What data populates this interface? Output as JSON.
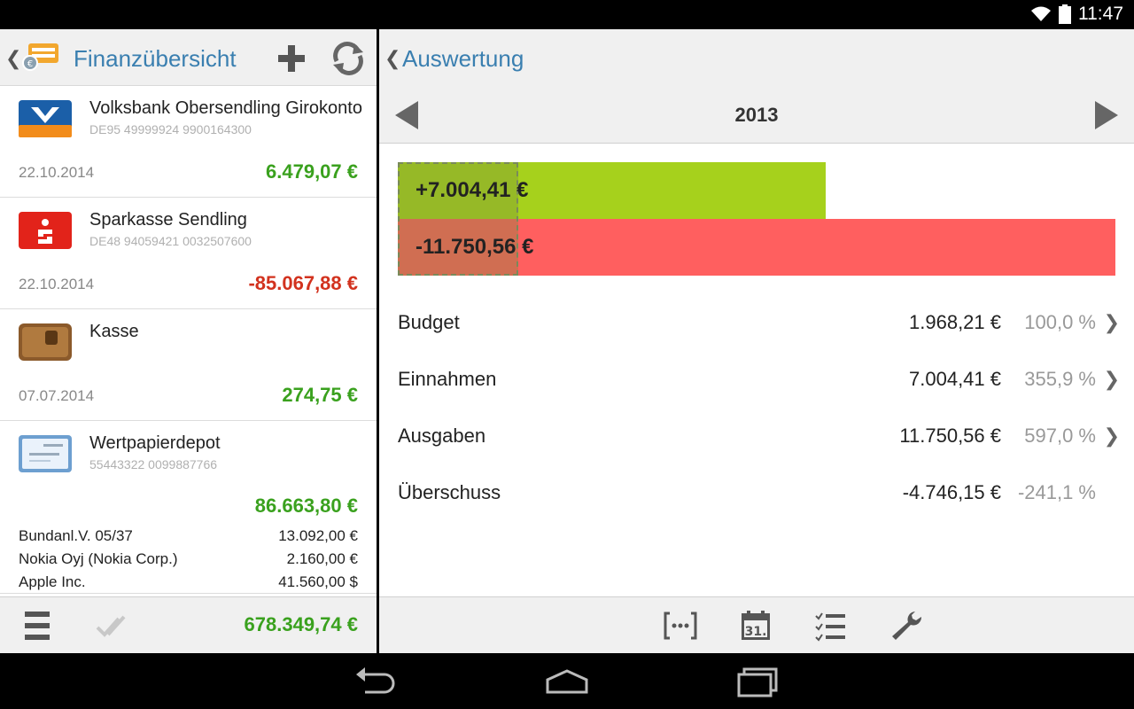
{
  "status_bar": {
    "time": "11:47"
  },
  "left": {
    "title": "Finanzübersicht",
    "accounts": [
      {
        "name": "Volksbank Obersendling Girokonto",
        "iban": "DE95 49999924 9900164300",
        "date": "22.10.2014",
        "balance": "6.479,07 €",
        "icon": "volksbank-icon",
        "positive": true
      },
      {
        "name": "Sparkasse Sendling",
        "iban": "DE48 94059421 0032507600",
        "date": "22.10.2014",
        "balance": "-85.067,88 €",
        "icon": "sparkasse-icon",
        "positive": false
      },
      {
        "name": "Kasse",
        "iban": "",
        "date": "07.07.2014",
        "balance": "274,75 €",
        "icon": "wallet-icon",
        "positive": true
      }
    ],
    "depot": {
      "name": "Wertpapierdepot",
      "number": "55443322 0099887766",
      "balance": "86.663,80 €",
      "holdings": [
        {
          "name": "Bundanl.V. 05/37",
          "value": "13.092,00 €"
        },
        {
          "name": "Nokia Oyj (Nokia Corp.)",
          "value": "2.160,00 €"
        },
        {
          "name": "Apple Inc.",
          "value": "41.560,00 $"
        }
      ]
    },
    "total": "678.349,74 €"
  },
  "right": {
    "title": "Auswertung",
    "year": "2013",
    "bars": {
      "income_label": "+7.004,41 €",
      "expense_label": "-11.750,56 €",
      "income_value": 7004.41,
      "expense_value": 11750.56,
      "budget_value": 1968.21,
      "income_color": "#a6d11c",
      "expense_color": "#ff5f5f"
    },
    "summary": [
      {
        "label": "Budget",
        "amount": "1.968,21 €",
        "percent": "100,0 %",
        "chevron": "❯"
      },
      {
        "label": "Einnahmen",
        "amount": "7.004,41 €",
        "percent": "355,9 %",
        "chevron": "❯"
      },
      {
        "label": "Ausgaben",
        "amount": "11.750,56 €",
        "percent": "597,0 %",
        "chevron": "❯"
      },
      {
        "label": "Überschuss",
        "amount": "-4.746,15 €",
        "percent": "-241,1 %",
        "chevron": ""
      }
    ]
  },
  "colors": {
    "accent": "#3a7fb0",
    "positive": "#3aa11e",
    "negative": "#d2321e"
  }
}
